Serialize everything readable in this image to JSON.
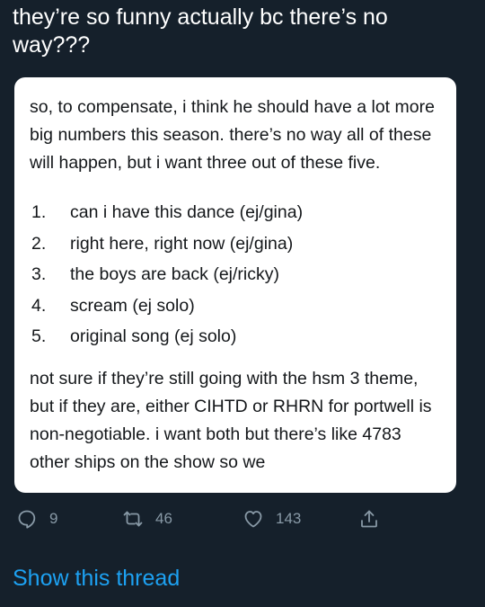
{
  "tweet": {
    "text": "they’re so funny actually bc there’s no way???"
  },
  "quoted": {
    "intro": "so, to compensate, i think he should have a lot more big numbers this season. there’s no way all of these will happen, but i want three out of these five.",
    "list": [
      {
        "num": "1.",
        "text": "can i have this dance (ej/gina)"
      },
      {
        "num": "2.",
        "text": "right here, right now (ej/gina)"
      },
      {
        "num": "3.",
        "text": "the boys are back (ej/ricky)"
      },
      {
        "num": "4.",
        "text": "scream (ej solo)"
      },
      {
        "num": "5.",
        "text": "original song (ej solo)"
      }
    ],
    "outro": "not sure if they’re still going with the hsm 3 theme, but if they are, either CIHTD or RHRN for portwell is non-negotiable. i want both but there’s like 4783 other ships on the show so we"
  },
  "actions": {
    "replies": "9",
    "retweets": "46",
    "likes": "143",
    "reply_icon": "reply-icon",
    "retweet_icon": "retweet-icon",
    "like_icon": "heart-icon",
    "share_icon": "share-icon"
  },
  "show_thread": "Show this thread",
  "colors": {
    "background": "#15202b",
    "card": "#ffffff",
    "muted": "#8899a6",
    "link": "#1da1f2"
  }
}
